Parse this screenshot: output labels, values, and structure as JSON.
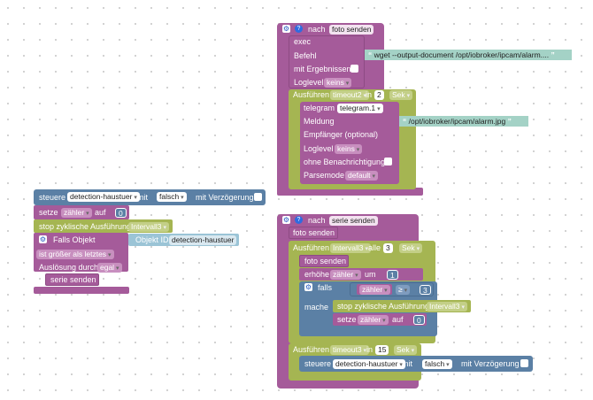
{
  "colors": {
    "purple": "#a55b9a",
    "green": "#a5b552",
    "blue": "#5b80a5",
    "string": "#a4d2c6",
    "number_field": "#ffffff"
  },
  "top": {
    "header": "nach",
    "name": "foto senden",
    "exec": "exec",
    "befehl": "Befehl",
    "befehl_value": "wget --output-document /opt/iobroker/ipcam/alarm....",
    "mit_ergebnissen": "mit Ergebnissen",
    "loglevel": "Loglevel",
    "loglevel_value": "keins",
    "ausfuehren": "Ausführen",
    "timeout": "timeout2",
    "in": "in",
    "in_value": "2",
    "unit": "Sek",
    "telegram": "telegram",
    "telegram_value": "telegram.1",
    "meldung": "Meldung",
    "meldung_value": "/opt/iobroker/ipcam/alarm.jpg",
    "empfaenger": "Empfänger (optional)",
    "loglevel2": "Loglevel",
    "loglevel2_value": "keins",
    "ohne_benachrichtigung": "ohne Benachrichtigung",
    "parsemode": "Parsemode",
    "parsemode_value": "default"
  },
  "left": {
    "steuere": "steuere",
    "device": "detection-haustuer",
    "mit": "mit",
    "falsch": "falsch",
    "mit_verzoegerung": "mit Verzögerung",
    "setze": "setze",
    "var": "zähler",
    "auf": "auf",
    "auf_value": "0",
    "stop": "stop zyklische Ausführung",
    "interval": "Intervall3",
    "falls_objekt": "Falls Objekt",
    "objekt_id": "Objekt ID",
    "objekt_value": "detection-haustuer",
    "ist_groesser": "ist größer als letztes",
    "ausloesung": "Auslösung durch",
    "egal": "egal",
    "serie_senden": "serie senden"
  },
  "bottom": {
    "header": "nach",
    "name": "serie senden",
    "foto_senden": "foto senden",
    "ausfuehren": "Ausführen",
    "interval": "Intervall3",
    "alle": "alle",
    "alle_value": "3",
    "unit": "Sek",
    "foto_senden2": "foto senden",
    "erhoehe": "erhöhe",
    "var": "zähler",
    "um": "um",
    "um_value": "1",
    "falls": "falls",
    "cmp_var": "zähler",
    "op": "≥",
    "cmp_value": "3",
    "mache": "mache",
    "stop": "stop zyklische Ausführung",
    "stop_interval": "Intervall3",
    "setze": "setze",
    "setze_var": "zähler",
    "auf": "auf",
    "auf_value": "0",
    "ausfuehren2": "Ausführen",
    "timeout": "timeout3",
    "in": "in",
    "in_value": "15",
    "unit2": "Sek",
    "steuere": "steuere",
    "device": "detection-haustuer",
    "mit": "mit",
    "falsch": "falsch",
    "mit_verzoegerung": "mit Verzögerung"
  }
}
